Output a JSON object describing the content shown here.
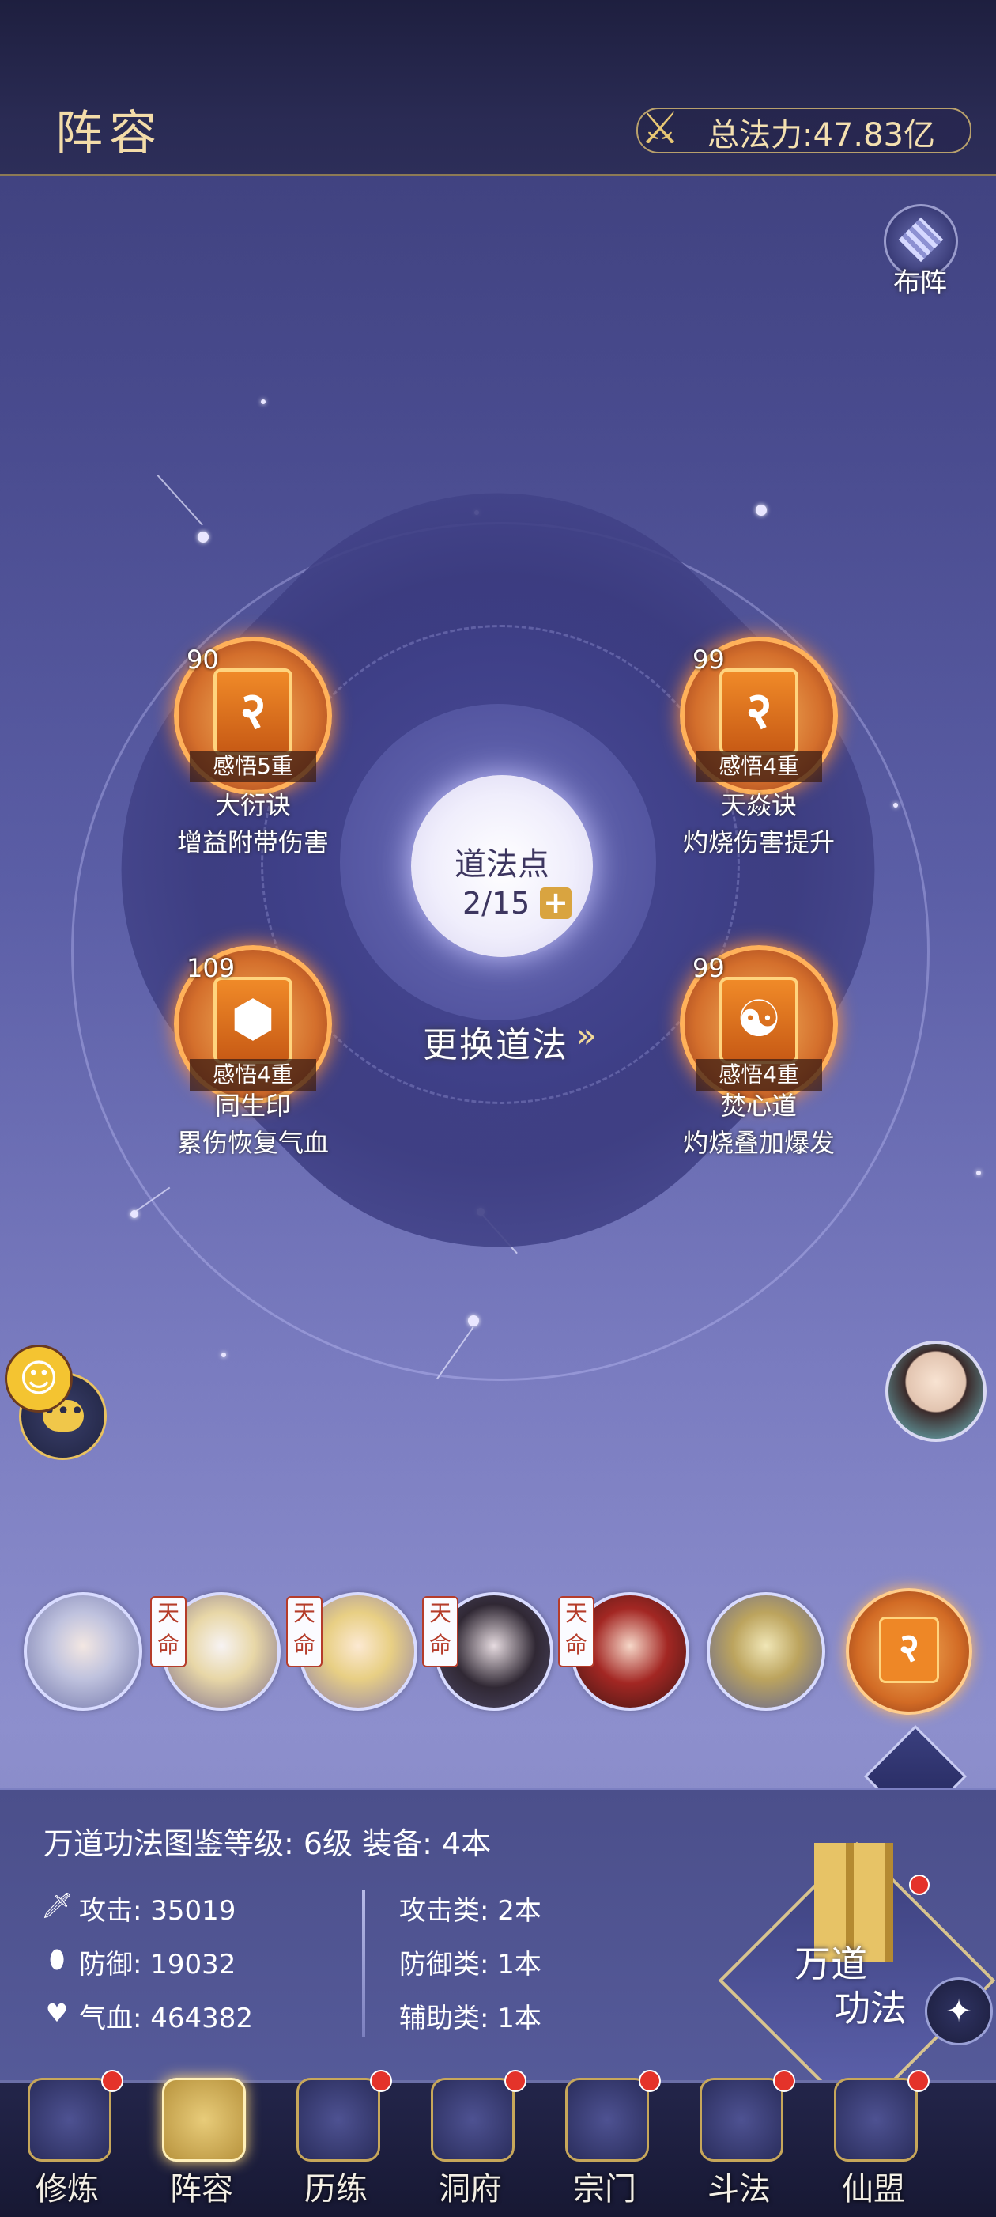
{
  "header": {
    "title": "阵容",
    "power_label": "总法力:47.83亿"
  },
  "formation_button": {
    "label": "布阵"
  },
  "center": {
    "title": "道法点",
    "value": "2/15",
    "plus": "+",
    "swap_label": "更换道法",
    "swap_arrow": "»"
  },
  "skills": [
    {
      "level": "90",
      "insight": "感悟5重",
      "name": "大衍诀",
      "desc": "增益附带伤害"
    },
    {
      "level": "99",
      "insight": "感悟4重",
      "name": "天焱诀",
      "desc": "灼烧伤害提升"
    },
    {
      "level": "109",
      "insight": "感悟4重",
      "name": "同生印",
      "desc": "累伤恢复气血"
    },
    {
      "level": "99",
      "insight": "感悟4重",
      "name": "焚心道",
      "desc": "灼烧叠加爆发"
    }
  ],
  "team": {
    "badge": "天命",
    "members": [
      {
        "id": "member-1"
      },
      {
        "id": "member-2"
      },
      {
        "id": "member-3"
      },
      {
        "id": "member-4"
      },
      {
        "id": "member-5"
      },
      {
        "id": "member-6"
      },
      {
        "id": "member-7"
      }
    ]
  },
  "change_button": {
    "label": "更换"
  },
  "stats": {
    "header": "万道功法图鉴等级: 6级   装备: 4本",
    "attack": "攻击: 35019",
    "defense": "防御: 19032",
    "hp": "气血: 464382",
    "attack_type": "攻击类: 2本",
    "defense_type": "防御类: 1本",
    "support_type": "辅助类: 1本"
  },
  "wandao": {
    "line1": "万道",
    "line2": "功法"
  },
  "nav": [
    {
      "label": "修炼",
      "active": false,
      "dot": true
    },
    {
      "label": "阵容",
      "active": true,
      "dot": false
    },
    {
      "label": "历练",
      "active": false,
      "dot": true
    },
    {
      "label": "洞府",
      "active": false,
      "dot": true
    },
    {
      "label": "宗门",
      "active": false,
      "dot": true
    },
    {
      "label": "斗法",
      "active": false,
      "dot": true
    },
    {
      "label": "仙盟",
      "active": false,
      "dot": true
    }
  ],
  "colors": {
    "gold": "#f3dca9",
    "accent_orange": "#f08a28",
    "red_dot": "#e4332a",
    "panel": "#4b4f8b"
  },
  "icons": {
    "power": "crossed-swords-icon",
    "formation": "grid-diamond-icon",
    "chat": "chat-bubble-icon",
    "pet": "pet-icon",
    "attack": "sword-icon",
    "defense": "shield-icon",
    "hp": "heart-icon",
    "settings": "shuriken-icon"
  }
}
